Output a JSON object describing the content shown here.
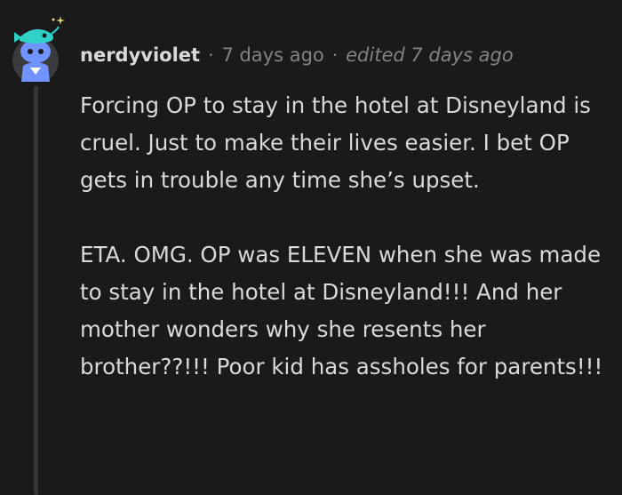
{
  "comment": {
    "avatar_icon": "snoo-avatar-icon",
    "username": "nerdyviolet",
    "separator": "·",
    "timestamp": "7 days ago",
    "edited": "edited 7 days ago",
    "paragraphs": [
      "Forcing OP to stay in the hotel at Disneyland is cruel. Just to make their lives easier. I bet OP gets in trouble any time she’s upset.",
      "ETA. OMG. OP was ELEVEN when she was made to stay in the hotel at Disneyland!!! And her mother wonders why she resents her brother??!!! Poor kid has assholes for parents!!!"
    ]
  },
  "colors": {
    "background": "#1a1a1b",
    "text": "#d7dadc",
    "meta": "#818384",
    "thread_line": "#343536",
    "avatar_body": "#7193ff",
    "avatar_hat": "#2fd1c6"
  }
}
